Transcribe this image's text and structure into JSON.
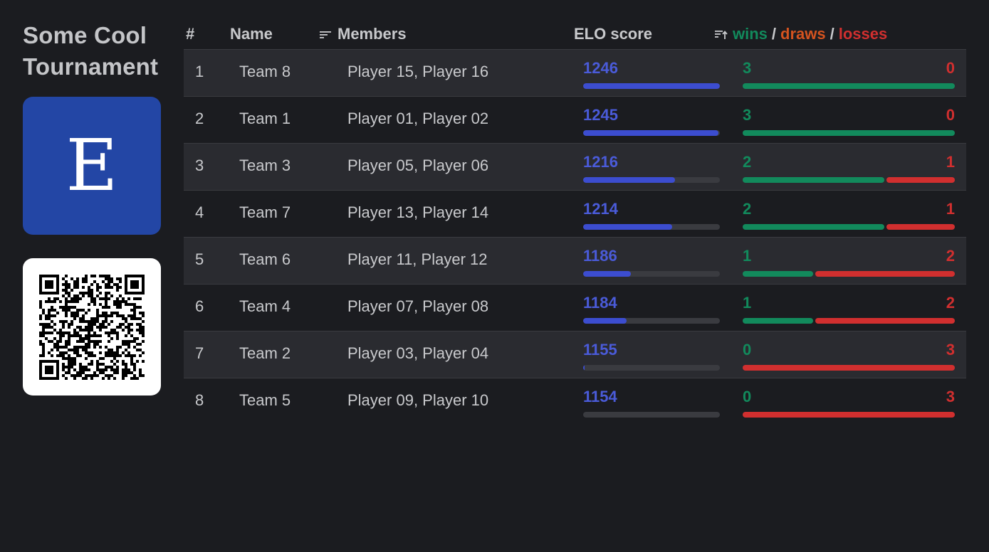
{
  "sidebar": {
    "title": "Some Cool\nTournament",
    "logo_letter": "E",
    "logo_color": "#2346a5",
    "qr_icon": "qr-code-icon"
  },
  "header": {
    "rank": "#",
    "name": "Name",
    "members": "Members",
    "elo": "ELO score",
    "wins": "wins",
    "sep1": "/",
    "draws": "draws",
    "sep2": "/",
    "losses": "losses"
  },
  "colors": {
    "elo": "#3c4dd0",
    "wins": "#128a5c",
    "draws": "#d4531f",
    "losses": "#d12f2f"
  },
  "elo_scale": {
    "min": 1154,
    "max": 1246
  },
  "rows": [
    {
      "rank": "1",
      "team": "Team 8",
      "members": "Player 15, Player 16",
      "elo": "1246",
      "wins": "3",
      "losses": "0",
      "elo_fraction": 1.0
    },
    {
      "rank": "2",
      "team": "Team 1",
      "members": "Player 01, Player 02",
      "elo": "1245",
      "wins": "3",
      "losses": "0",
      "elo_fraction": 0.99
    },
    {
      "rank": "3",
      "team": "Team 3",
      "members": "Player 05, Player 06",
      "elo": "1216",
      "wins": "2",
      "losses": "1",
      "elo_fraction": 0.67
    },
    {
      "rank": "4",
      "team": "Team 7",
      "members": "Player 13, Player 14",
      "elo": "1214",
      "wins": "2",
      "losses": "1",
      "elo_fraction": 0.65
    },
    {
      "rank": "5",
      "team": "Team 6",
      "members": "Player 11, Player 12",
      "elo": "1186",
      "wins": "1",
      "losses": "2",
      "elo_fraction": 0.35
    },
    {
      "rank": "6",
      "team": "Team 4",
      "members": "Player 07, Player 08",
      "elo": "1184",
      "wins": "1",
      "losses": "2",
      "elo_fraction": 0.32
    },
    {
      "rank": "7",
      "team": "Team 2",
      "members": "Player 03, Player 04",
      "elo": "1155",
      "wins": "0",
      "losses": "3",
      "elo_fraction": 0.01
    },
    {
      "rank": "8",
      "team": "Team 5",
      "members": "Player 09, Player 10",
      "elo": "1154",
      "wins": "0",
      "losses": "3",
      "elo_fraction": 0.0
    }
  ]
}
